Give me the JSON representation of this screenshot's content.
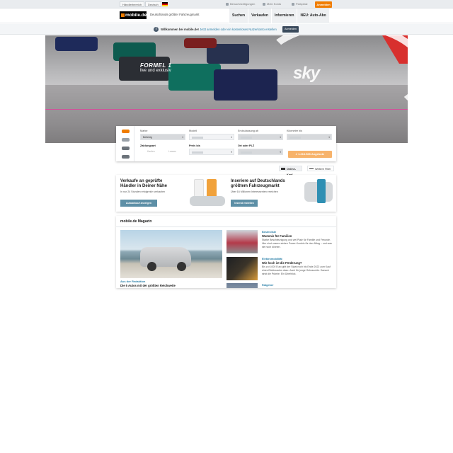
{
  "topbar": {
    "pills": [
      "Händlerbereich",
      "Deutsch"
    ],
    "util_links": [
      "Benachrichtigungen",
      "Mein Konto",
      "Parkplatz"
    ],
    "login_label": "Anmelden",
    "flag_colors": [
      "#000000",
      "#dd0000",
      "#ffce00"
    ]
  },
  "header": {
    "logo_text": "mobile.de",
    "tagline": "Deutschlands größter Fahrzeugmarkt",
    "nav": [
      "Suchen",
      "Verkaufen",
      "Informieren",
      "NEU: Auto-Abo"
    ]
  },
  "banner": {
    "icon": "info-icon",
    "message_bold": "Willkommen bei mobile.de!",
    "message_link": "Jetzt anmelden oder ein kostenloses Nutzerkonto erstellen",
    "register_label": "Anmelden"
  },
  "hero": {
    "f1_title": "FORMEL 1",
    "f1_sub": "live und exklusiv",
    "sky_logo": "sky",
    "accent": "#d8302e"
  },
  "search": {
    "marke": {
      "label": "Marke",
      "value": "Beliebig"
    },
    "modell": {
      "label": "Modell"
    },
    "erstzulassung": {
      "label": "Erstzulassung ab"
    },
    "kilometer": {
      "label": "Kilometer bis"
    },
    "zahlungsart": {
      "label": "Zahlungsart",
      "sub1": "Kaufen",
      "sub2": "Leasen"
    },
    "preis": {
      "label": "Preis bis"
    },
    "ort": {
      "label": "Ort oder PLZ"
    },
    "result_label": "1.216.526 Angebote",
    "accent": "#f07d00"
  },
  "actions": {
    "online_kauf": "Online-Kauf",
    "weitere_filter": "Weitere Filter"
  },
  "promo": {
    "left": {
      "title_line1": "Verkaufe an geprüfte",
      "title_line2": "Händler in Deiner Nähe",
      "desc": "In nur 24 Stunden erfolgreich verkaufen",
      "cta": "Autoankauf anzeigen"
    },
    "right": {
      "title_line1": "Inseriere auf Deutschlands",
      "title_line2": "größtem Fahrzeugmarkt",
      "desc": "Über 16 Millionen Interessenten erreichen",
      "cta": "Inserat erstellen"
    }
  },
  "magazin": {
    "title": "mobile.de Magazin",
    "main": {
      "kicker": "Aus der Redaktion",
      "headline": "Die 5 Autos mit der größten Reichweite"
    },
    "side": [
      {
        "kicker": "Bestenliste",
        "headline": "Wummis für Familien",
        "desc": "Starke Beschleunigung und viel Platz für Familie und Freunde. Hier sind unsere sieben Power-Kombis für den Alltag – und was sie noch können."
      },
      {
        "kicker": "Elektromobilität",
        "headline": "Wie hoch ist die Förderung?",
        "desc": "Bis zu 6.000 Euro gibt der Staat noch bis Ende 2022 zum Kauf eines Elektroautos dazu. Auch für junge Gebrauchte. Danach sinkt die Prämie. Ein Überblick."
      },
      {
        "kicker": "Ratgeber",
        "headline": "",
        "desc": ""
      }
    ]
  }
}
